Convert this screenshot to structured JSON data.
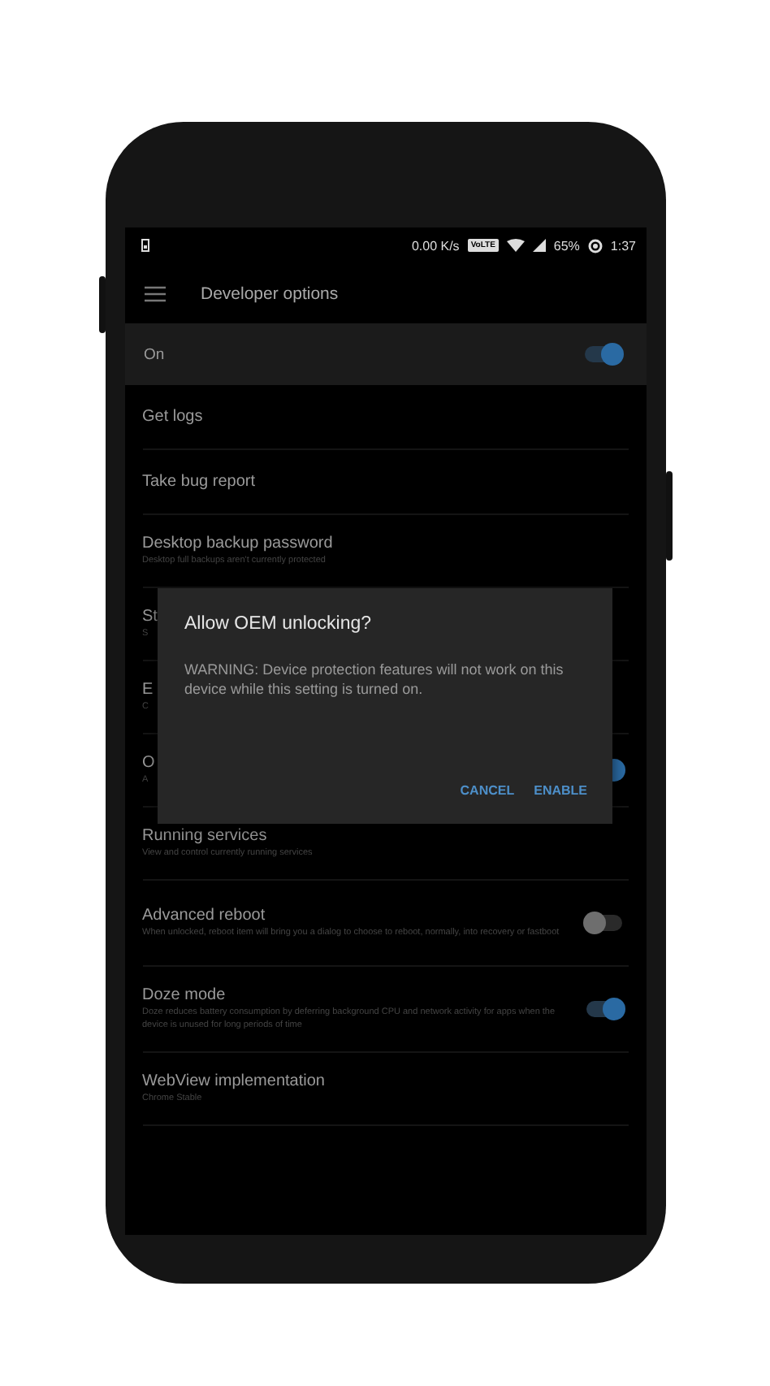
{
  "status_bar": {
    "speed": "0.00 K/s",
    "network_badge": "VoLTE",
    "battery": "65%",
    "time": "1:37"
  },
  "toolbar": {
    "title": "Developer options"
  },
  "master_switch": {
    "label": "On",
    "on": true
  },
  "items": [
    {
      "kind": "plain",
      "title": "Get logs"
    },
    {
      "kind": "plain",
      "title": "Take bug report"
    },
    {
      "kind": "plain",
      "title": "Desktop backup password",
      "subtitle": "Desktop full backups aren't currently protected"
    },
    {
      "kind": "plain",
      "title": "St",
      "subtitle": "S"
    },
    {
      "kind": "plain",
      "title": "E",
      "subtitle": "C"
    },
    {
      "kind": "switch",
      "title": "O",
      "subtitle": "A",
      "on": true
    },
    {
      "kind": "plain",
      "title": "Running services",
      "subtitle": "View and control currently running services"
    },
    {
      "kind": "switch",
      "title": "Advanced reboot",
      "subtitle": "When unlocked, reboot item will bring you a dialog to choose to reboot, normally, into recovery or fastboot",
      "on": false
    },
    {
      "kind": "switch",
      "title": "Doze mode",
      "subtitle": "Doze reduces battery consumption by deferring background CPU and network activity for apps when the device is unused for long periods of time",
      "on": true
    },
    {
      "kind": "plain",
      "title": "WebView implementation",
      "subtitle": "Chrome Stable"
    }
  ],
  "dialog": {
    "title": "Allow OEM unlocking?",
    "message": "WARNING: Device protection features will not work on this device while this setting is turned on.",
    "buttons": [
      "CANCEL",
      "ENABLE"
    ]
  }
}
